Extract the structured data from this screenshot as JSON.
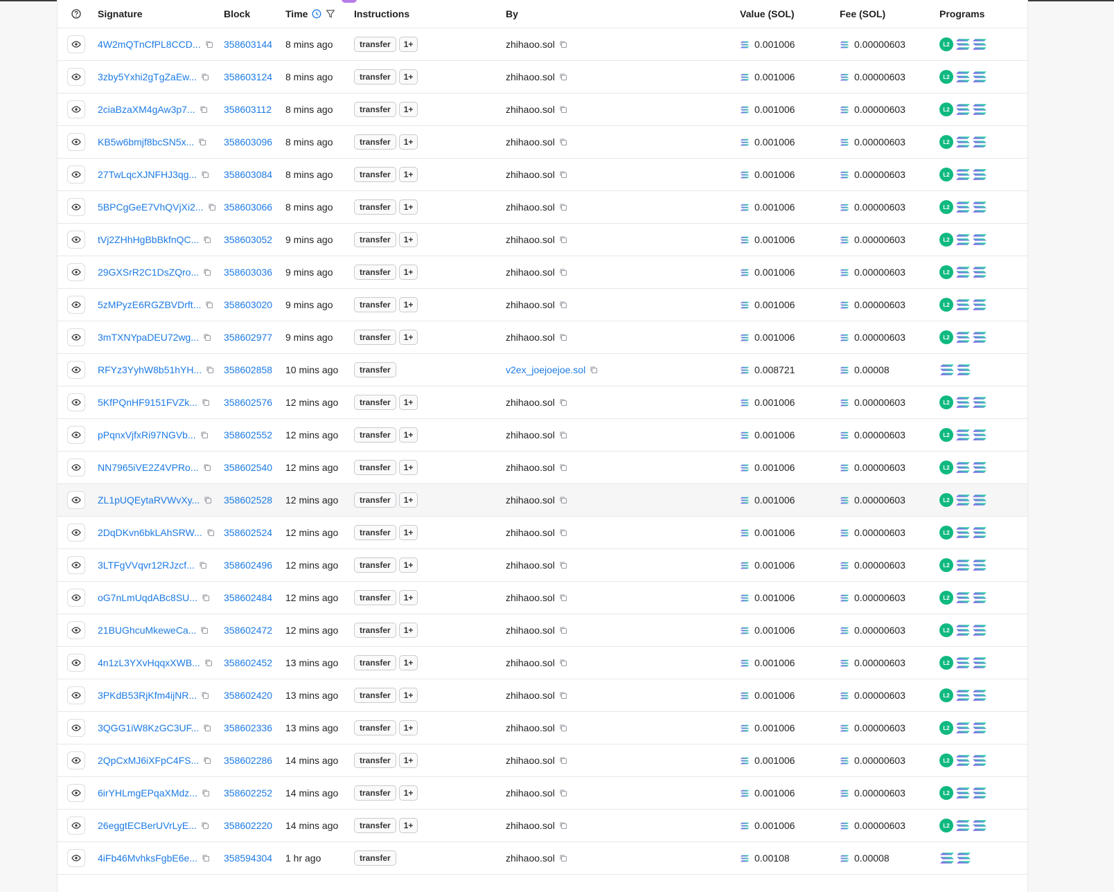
{
  "header": {
    "help_icon": "question-circle-icon",
    "signature": "Signature",
    "block": "Block",
    "time": "Time",
    "instructions": "Instructions",
    "by": "By",
    "value": "Value (SOL)",
    "fee": "Fee (SOL)",
    "programs": "Programs"
  },
  "colors": {
    "link": "#1d7be5",
    "l2_badge": "#10b981",
    "sol_gradient_start": "#9945ff",
    "sol_gradient_end": "#14f195"
  },
  "rows": [
    {
      "signature": "4W2mQTnCfPL8CCD...",
      "block": "358603144",
      "time": "8 mins ago",
      "instruction": "transfer",
      "more": "1+",
      "by": "zhihaoo.sol",
      "by_link": false,
      "value": "0.001006",
      "fee": "0.00000603",
      "programs": [
        "l2",
        "sol",
        "sol"
      ]
    },
    {
      "signature": "3zby5Yxhi2gTgZaEw...",
      "block": "358603124",
      "time": "8 mins ago",
      "instruction": "transfer",
      "more": "1+",
      "by": "zhihaoo.sol",
      "by_link": false,
      "value": "0.001006",
      "fee": "0.00000603",
      "programs": [
        "l2",
        "sol",
        "sol"
      ]
    },
    {
      "signature": "2ciaBzaXM4gAw3p7...",
      "block": "358603112",
      "time": "8 mins ago",
      "instruction": "transfer",
      "more": "1+",
      "by": "zhihaoo.sol",
      "by_link": false,
      "value": "0.001006",
      "fee": "0.00000603",
      "programs": [
        "l2",
        "sol",
        "sol"
      ]
    },
    {
      "signature": "KB5w6bmjf8bcSN5x...",
      "block": "358603096",
      "time": "8 mins ago",
      "instruction": "transfer",
      "more": "1+",
      "by": "zhihaoo.sol",
      "by_link": false,
      "value": "0.001006",
      "fee": "0.00000603",
      "programs": [
        "l2",
        "sol",
        "sol"
      ]
    },
    {
      "signature": "27TwLqcXJNFHJ3qg...",
      "block": "358603084",
      "time": "8 mins ago",
      "instruction": "transfer",
      "more": "1+",
      "by": "zhihaoo.sol",
      "by_link": false,
      "value": "0.001006",
      "fee": "0.00000603",
      "programs": [
        "l2",
        "sol",
        "sol"
      ]
    },
    {
      "signature": "5BPCgGeE7VhQVjXi2...",
      "block": "358603066",
      "time": "8 mins ago",
      "instruction": "transfer",
      "more": "1+",
      "by": "zhihaoo.sol",
      "by_link": false,
      "value": "0.001006",
      "fee": "0.00000603",
      "programs": [
        "l2",
        "sol",
        "sol"
      ]
    },
    {
      "signature": "tVj2ZHhHgBbBkfnQC...",
      "block": "358603052",
      "time": "9 mins ago",
      "instruction": "transfer",
      "more": "1+",
      "by": "zhihaoo.sol",
      "by_link": false,
      "value": "0.001006",
      "fee": "0.00000603",
      "programs": [
        "l2",
        "sol",
        "sol"
      ]
    },
    {
      "signature": "29GXSrR2C1DsZQro...",
      "block": "358603036",
      "time": "9 mins ago",
      "instruction": "transfer",
      "more": "1+",
      "by": "zhihaoo.sol",
      "by_link": false,
      "value": "0.001006",
      "fee": "0.00000603",
      "programs": [
        "l2",
        "sol",
        "sol"
      ]
    },
    {
      "signature": "5zMPyzE6RGZBVDrft...",
      "block": "358603020",
      "time": "9 mins ago",
      "instruction": "transfer",
      "more": "1+",
      "by": "zhihaoo.sol",
      "by_link": false,
      "value": "0.001006",
      "fee": "0.00000603",
      "programs": [
        "l2",
        "sol",
        "sol"
      ]
    },
    {
      "signature": "3mTXNYpaDEU72wg...",
      "block": "358602977",
      "time": "9 mins ago",
      "instruction": "transfer",
      "more": "1+",
      "by": "zhihaoo.sol",
      "by_link": false,
      "value": "0.001006",
      "fee": "0.00000603",
      "programs": [
        "l2",
        "sol",
        "sol"
      ]
    },
    {
      "signature": "RFYz3YyhW8b51hYH...",
      "block": "358602858",
      "time": "10 mins ago",
      "instruction": "transfer",
      "more": "",
      "by": "v2ex_joejoejoe.sol",
      "by_link": true,
      "value": "0.008721",
      "fee": "0.00008",
      "programs": [
        "sol",
        "sol"
      ]
    },
    {
      "signature": "5KfPQnHF9151FVZk...",
      "block": "358602576",
      "time": "12 mins ago",
      "instruction": "transfer",
      "more": "1+",
      "by": "zhihaoo.sol",
      "by_link": false,
      "value": "0.001006",
      "fee": "0.00000603",
      "programs": [
        "l2",
        "sol",
        "sol"
      ]
    },
    {
      "signature": "pPqnxVjfxRi97NGVb...",
      "block": "358602552",
      "time": "12 mins ago",
      "instruction": "transfer",
      "more": "1+",
      "by": "zhihaoo.sol",
      "by_link": false,
      "value": "0.001006",
      "fee": "0.00000603",
      "programs": [
        "l2",
        "sol",
        "sol"
      ]
    },
    {
      "signature": "NN7965iVE2Z4VPRo...",
      "block": "358602540",
      "time": "12 mins ago",
      "instruction": "transfer",
      "more": "1+",
      "by": "zhihaoo.sol",
      "by_link": false,
      "value": "0.001006",
      "fee": "0.00000603",
      "programs": [
        "l2",
        "sol",
        "sol"
      ]
    },
    {
      "signature": "ZL1pUQEytaRVWvXy...",
      "block": "358602528",
      "time": "12 mins ago",
      "instruction": "transfer",
      "more": "1+",
      "by": "zhihaoo.sol",
      "by_link": false,
      "value": "0.001006",
      "fee": "0.00000603",
      "programs": [
        "l2",
        "sol",
        "sol"
      ]
    },
    {
      "signature": "2DqDKvn6bkLAhSRW...",
      "block": "358602524",
      "time": "12 mins ago",
      "instruction": "transfer",
      "more": "1+",
      "by": "zhihaoo.sol",
      "by_link": false,
      "value": "0.001006",
      "fee": "0.00000603",
      "programs": [
        "l2",
        "sol",
        "sol"
      ]
    },
    {
      "signature": "3LTFgVVqvr12RJzcf...",
      "block": "358602496",
      "time": "12 mins ago",
      "instruction": "transfer",
      "more": "1+",
      "by": "zhihaoo.sol",
      "by_link": false,
      "value": "0.001006",
      "fee": "0.00000603",
      "programs": [
        "l2",
        "sol",
        "sol"
      ]
    },
    {
      "signature": "oG7nLmUqdABc8SU...",
      "block": "358602484",
      "time": "12 mins ago",
      "instruction": "transfer",
      "more": "1+",
      "by": "zhihaoo.sol",
      "by_link": false,
      "value": "0.001006",
      "fee": "0.00000603",
      "programs": [
        "l2",
        "sol",
        "sol"
      ]
    },
    {
      "signature": "21BUGhcuMkeweCa...",
      "block": "358602472",
      "time": "12 mins ago",
      "instruction": "transfer",
      "more": "1+",
      "by": "zhihaoo.sol",
      "by_link": false,
      "value": "0.001006",
      "fee": "0.00000603",
      "programs": [
        "l2",
        "sol",
        "sol"
      ]
    },
    {
      "signature": "4n1zL3YXvHqqxXWB...",
      "block": "358602452",
      "time": "13 mins ago",
      "instruction": "transfer",
      "more": "1+",
      "by": "zhihaoo.sol",
      "by_link": false,
      "value": "0.001006",
      "fee": "0.00000603",
      "programs": [
        "l2",
        "sol",
        "sol"
      ]
    },
    {
      "signature": "3PKdB53RjKfm4ijNR...",
      "block": "358602420",
      "time": "13 mins ago",
      "instruction": "transfer",
      "more": "1+",
      "by": "zhihaoo.sol",
      "by_link": false,
      "value": "0.001006",
      "fee": "0.00000603",
      "programs": [
        "l2",
        "sol",
        "sol"
      ]
    },
    {
      "signature": "3QGG1iW8KzGC3UF...",
      "block": "358602336",
      "time": "13 mins ago",
      "instruction": "transfer",
      "more": "1+",
      "by": "zhihaoo.sol",
      "by_link": false,
      "value": "0.001006",
      "fee": "0.00000603",
      "programs": [
        "l2",
        "sol",
        "sol"
      ]
    },
    {
      "signature": "2QpCxMJ6iXFpC4FS...",
      "block": "358602286",
      "time": "14 mins ago",
      "instruction": "transfer",
      "more": "1+",
      "by": "zhihaoo.sol",
      "by_link": false,
      "value": "0.001006",
      "fee": "0.00000603",
      "programs": [
        "l2",
        "sol",
        "sol"
      ]
    },
    {
      "signature": "6irYHLmgEPqaXMdz...",
      "block": "358602252",
      "time": "14 mins ago",
      "instruction": "transfer",
      "more": "1+",
      "by": "zhihaoo.sol",
      "by_link": false,
      "value": "0.001006",
      "fee": "0.00000603",
      "programs": [
        "l2",
        "sol",
        "sol"
      ]
    },
    {
      "signature": "26eggtECBerUVrLyE...",
      "block": "358602220",
      "time": "14 mins ago",
      "instruction": "transfer",
      "more": "1+",
      "by": "zhihaoo.sol",
      "by_link": false,
      "value": "0.001006",
      "fee": "0.00000603",
      "programs": [
        "l2",
        "sol",
        "sol"
      ]
    },
    {
      "signature": "4iFb46MvhksFgbE6e...",
      "block": "358594304",
      "time": "1 hr ago",
      "instruction": "transfer",
      "more": "",
      "by": "zhihaoo.sol",
      "by_link": false,
      "value": "0.00108",
      "fee": "0.00008",
      "programs": [
        "sol",
        "sol"
      ]
    }
  ],
  "highlighted_row": 14,
  "l2_label": "L2"
}
